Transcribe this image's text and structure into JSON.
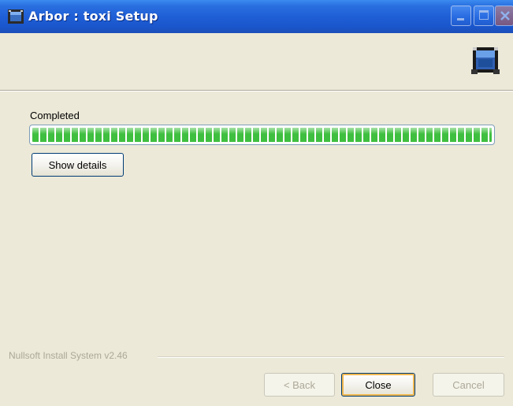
{
  "window": {
    "title": "Arbor : toxi Setup",
    "colors": {
      "titlebar": "#1f5fd6",
      "background": "#ece9d8",
      "progress_fill": "#3fbf3f",
      "focus_ring": "#f0b750"
    }
  },
  "titlebar_controls": {
    "minimize_icon": "minimize-icon",
    "maximize_icon": "maximize-icon",
    "close_icon": "close-icon"
  },
  "header": {
    "icon": "installer-icon"
  },
  "progress": {
    "status": "Completed",
    "value_percent": 100
  },
  "details_button": {
    "label": "Show details"
  },
  "branding": {
    "text": "Nullsoft Install System v2.46"
  },
  "footer": {
    "back_label": "< Back",
    "close_label": "Close",
    "cancel_label": "Cancel"
  }
}
